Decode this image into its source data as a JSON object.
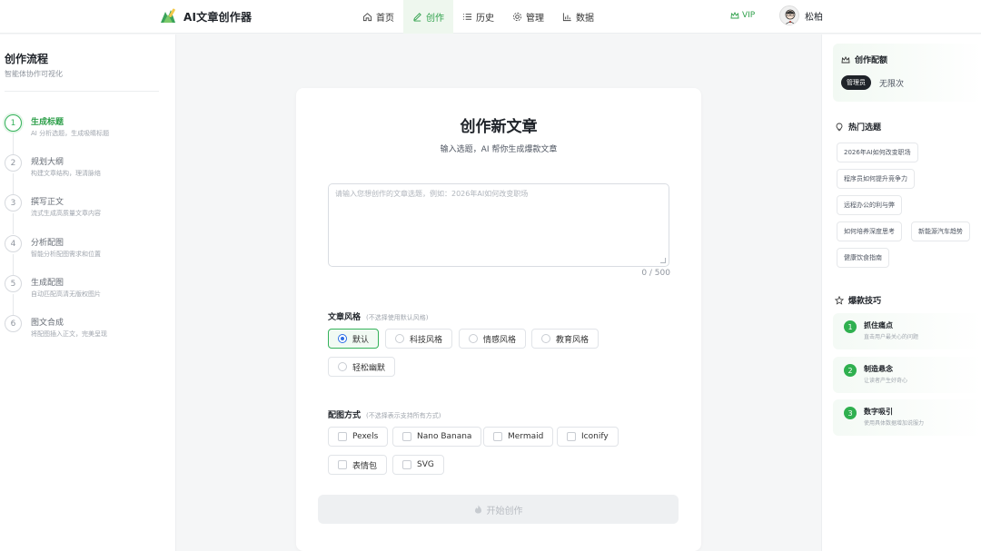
{
  "app": {
    "name": "AI文章创作器",
    "brand_color": "#2fa04b"
  },
  "nav": {
    "items": [
      {
        "label": "首页",
        "icon": "home-icon"
      },
      {
        "label": "创作",
        "icon": "pen-icon",
        "active": true
      },
      {
        "label": "历史",
        "icon": "list-icon"
      },
      {
        "label": "管理",
        "icon": "gear-icon"
      },
      {
        "label": "数据",
        "icon": "chart-icon"
      }
    ],
    "vip_label": "VIP",
    "user_name": "松柏"
  },
  "workflow": {
    "title": "创作流程",
    "subtitle": "智能体协作可视化",
    "steps": [
      {
        "num": "1",
        "title": "生成标题",
        "desc": "AI 分析选题，生成吸睛标题",
        "active": true
      },
      {
        "num": "2",
        "title": "规划大纲",
        "desc": "构建文章结构，理清脉络"
      },
      {
        "num": "3",
        "title": "撰写正文",
        "desc": "流式生成高质量文章内容"
      },
      {
        "num": "4",
        "title": "分析配图",
        "desc": "智能分析配图需求和位置"
      },
      {
        "num": "5",
        "title": "生成配图",
        "desc": "自动匹配高清无版权图片"
      },
      {
        "num": "6",
        "title": "图文合成",
        "desc": "将配图插入正文，完美呈现"
      }
    ]
  },
  "editor": {
    "title": "创作新文章",
    "subtitle": "输入选题，AI 帮你生成爆款文章",
    "placeholder": "请输入您想创作的文章选题，例如：2026年AI如何改变职场",
    "value": "",
    "counter": "0 / 500",
    "style_label": "文章风格",
    "style_hint": "(不选择使用默认风格)",
    "styles": [
      {
        "label": "默认",
        "selected": true
      },
      {
        "label": "科技风格"
      },
      {
        "label": "情感风格"
      },
      {
        "label": "教育风格"
      },
      {
        "label": "轻松幽默"
      }
    ],
    "image_label": "配图方式",
    "image_hint": "(不选择表示支持所有方式)",
    "image_methods": [
      {
        "label": "Pexels"
      },
      {
        "label": "Nano Banana"
      },
      {
        "label": "Mermaid"
      },
      {
        "label": "Iconify"
      },
      {
        "label": "表情包"
      },
      {
        "label": "SVG"
      }
    ],
    "start_label": "开始创作"
  },
  "quota": {
    "title": "创作配额",
    "role": "管理员",
    "value": "无限次"
  },
  "hot_topics": {
    "title": "热门选题",
    "items": [
      "2026年AI如何改变职场",
      "程序员如何提升竞争力",
      "远程办公的利与弊",
      "如何培养深度思考",
      "新能源汽车趋势",
      "健康饮食指南"
    ]
  },
  "tips": {
    "title": "爆款技巧",
    "items": [
      {
        "num": "1",
        "title": "抓住痛点",
        "desc": "直击用户最关心的问题"
      },
      {
        "num": "2",
        "title": "制造悬念",
        "desc": "让读者产生好奇心"
      },
      {
        "num": "3",
        "title": "数字吸引",
        "desc": "使用具体数据增加说服力"
      }
    ]
  }
}
